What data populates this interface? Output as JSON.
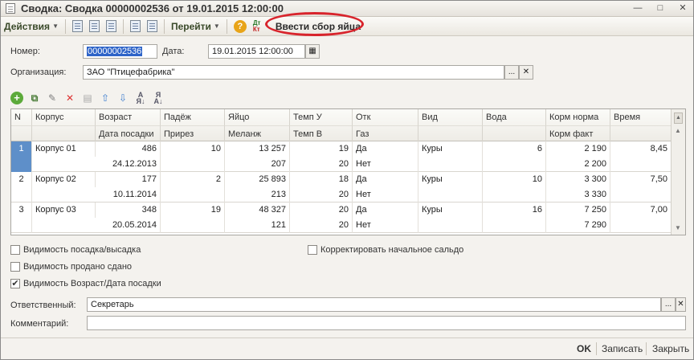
{
  "window": {
    "title": "Сводка: Сводка 00000002536 от 19.01.2015 12:00:00",
    "controls": [
      "—",
      "□",
      "✕"
    ]
  },
  "toolbar": {
    "actions_menu": "Действия",
    "goto_menu": "Перейти",
    "help_label": "?",
    "dtkt": [
      "Дт",
      "Кт"
    ],
    "enter_collection": "Ввести сбор яйца",
    "highlight_color": "#d8242c"
  },
  "form": {
    "number_label": "Номер:",
    "number_value": "00000002536",
    "date_label": "Дата:",
    "date_value": "19.01.2015 12:00:00",
    "org_label": "Организация:",
    "org_value": "ЗАО \"Птицефабрика\"",
    "responsible_label": "Ответственный:",
    "responsible_value": "Секретарь",
    "comment_label": "Комментарий:",
    "comment_value": "",
    "pick_label": "...",
    "clear_label": "✕"
  },
  "table": {
    "headers_row1": [
      "N",
      "Корпус",
      "Возраст",
      "Падёж",
      "Яйцо",
      "Темп У",
      "Отк",
      "Вид",
      "Вода",
      "Корм норма",
      "Время"
    ],
    "headers_row2": [
      "",
      "",
      "Дата посадки",
      "Прирез",
      "Меланж",
      "Темп В",
      "Газ",
      "",
      "",
      "Корм факт",
      ""
    ],
    "rows": [
      {
        "n": "1",
        "korpus": "Корпус 01",
        "top": [
          "486",
          "10",
          "13 257",
          "19",
          "Да",
          "Куры",
          "6",
          "2 190",
          "8,45"
        ],
        "bottom": [
          "24.12.2013",
          "",
          "207",
          "20",
          "Нет",
          "",
          "",
          "2 200",
          ""
        ]
      },
      {
        "n": "2",
        "korpus": "Корпус 02",
        "top": [
          "177",
          "2",
          "25 893",
          "18",
          "Да",
          "Куры",
          "10",
          "3 300",
          "7,50"
        ],
        "bottom": [
          "10.11.2014",
          "",
          "213",
          "20",
          "Нет",
          "",
          "",
          "3 330",
          ""
        ]
      },
      {
        "n": "3",
        "korpus": "Корпус 03",
        "top": [
          "348",
          "19",
          "48 327",
          "20",
          "Да",
          "Куры",
          "16",
          "7 250",
          "7,00"
        ],
        "bottom": [
          "20.05.2014",
          "",
          "121",
          "20",
          "Нет",
          "",
          "",
          "7 290",
          ""
        ]
      }
    ],
    "selected_row": 0,
    "selection_color": "#5e8fc9"
  },
  "checkboxes": {
    "visibility_landing": {
      "label": "Видимость посадка/высадка",
      "checked": false
    },
    "visibility_sold": {
      "label": "Видимость продано сдано",
      "checked": false
    },
    "visibility_age": {
      "label": "Видимость Возраст/Дата посадки",
      "checked": true
    },
    "correct_balance": {
      "label": "Корректировать начальное сальдо",
      "checked": false
    }
  },
  "footer": {
    "ok": "OK",
    "save": "Записать",
    "close": "Закрыть"
  }
}
